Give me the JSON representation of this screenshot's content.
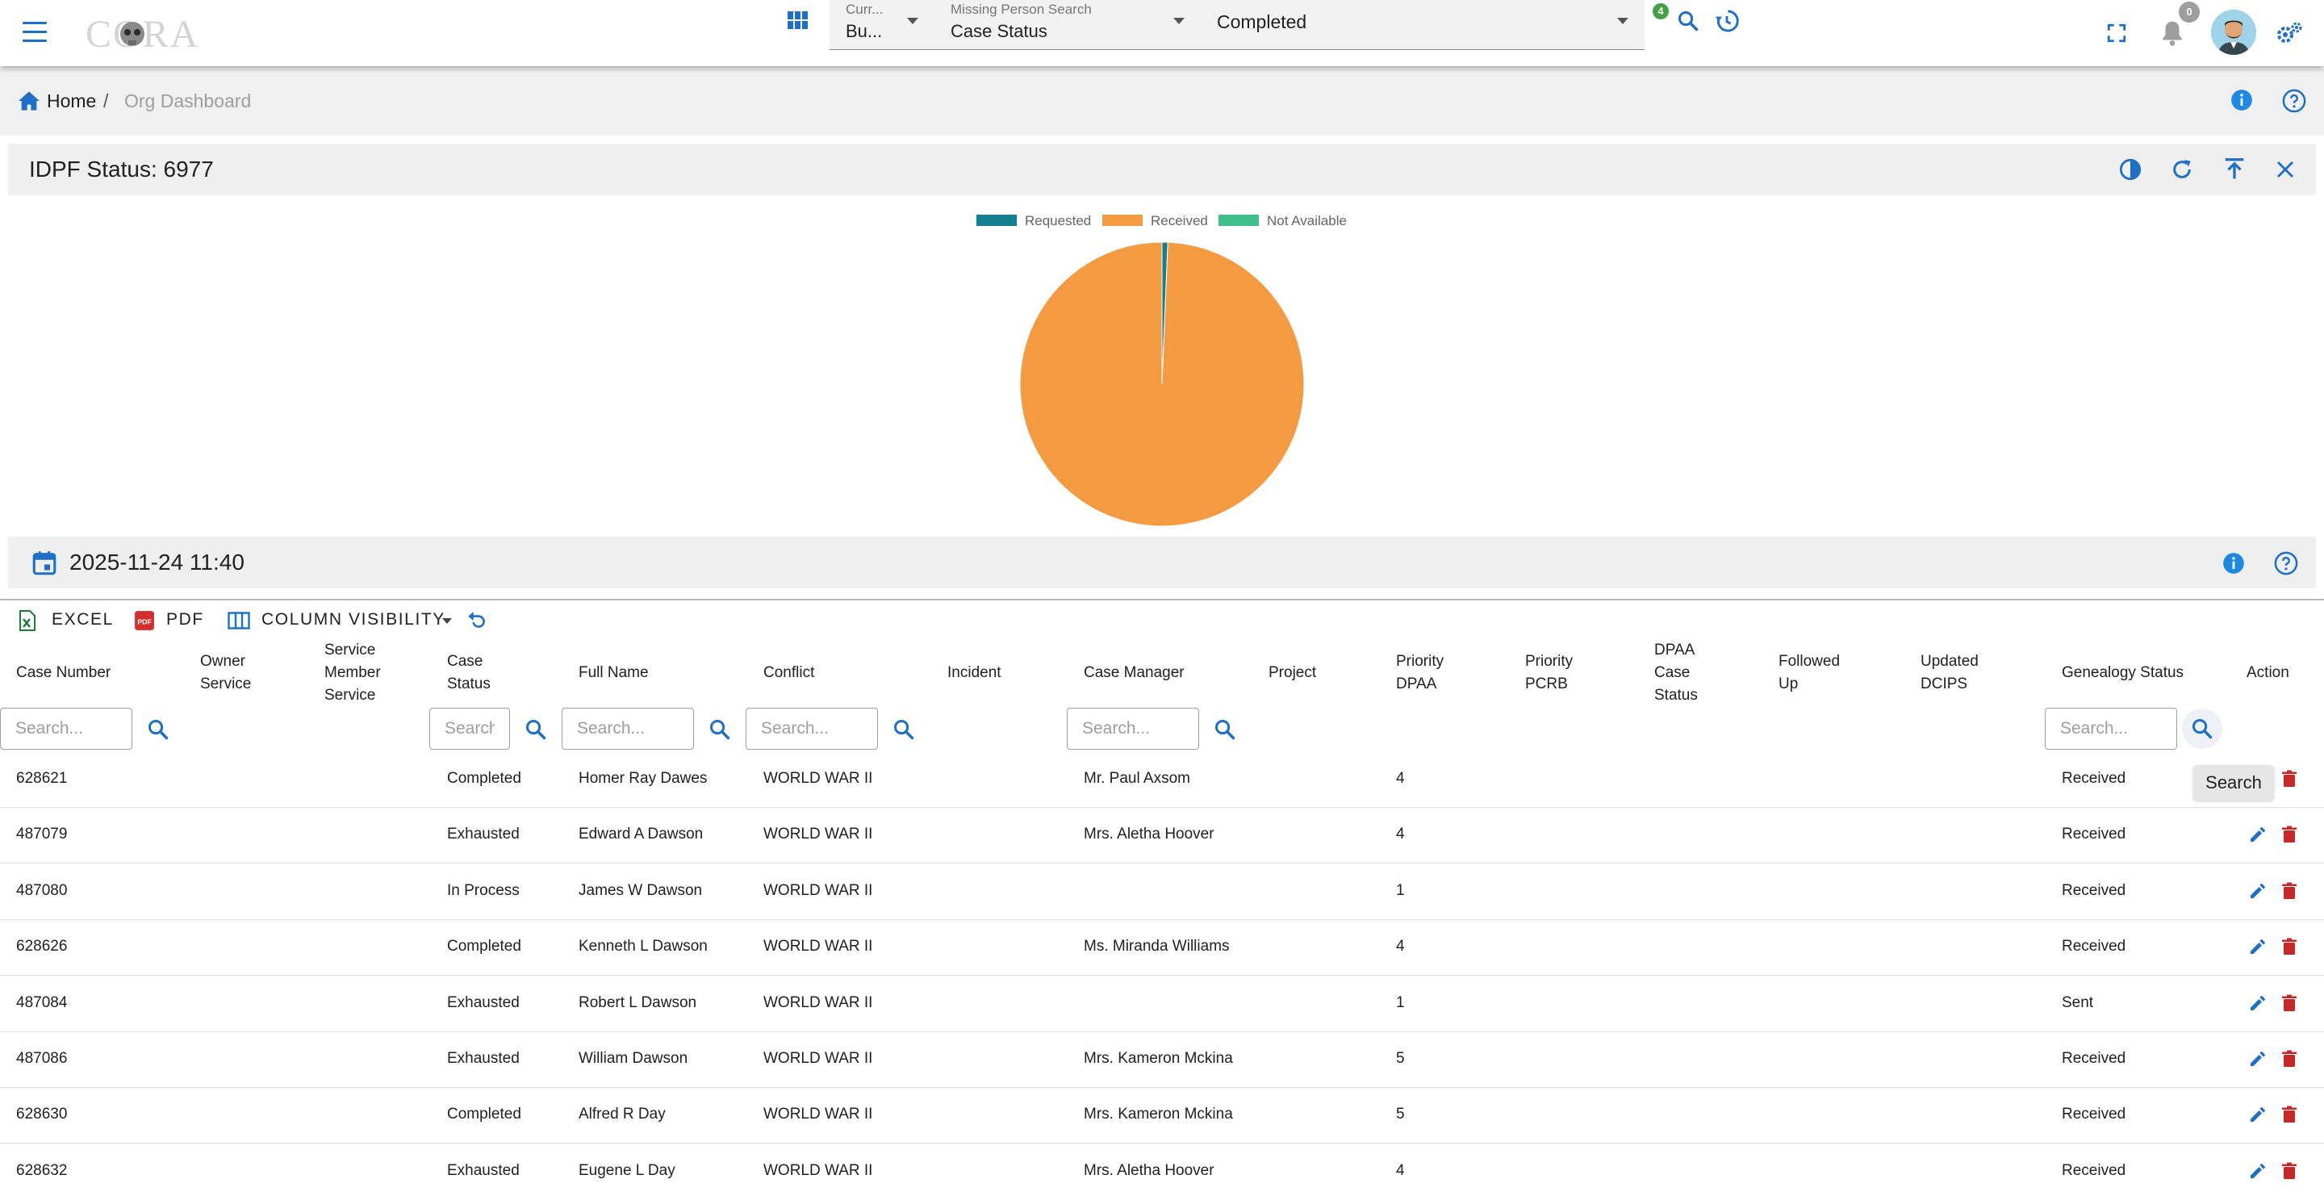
{
  "header": {
    "logo_text": "CORA",
    "current_label": "Curr...",
    "current_value": "Bu...",
    "search_type_label": "Missing Person Search",
    "search_type_value": "Case Status",
    "search_value": "Completed",
    "filter_badge": "4",
    "notification_count": "0"
  },
  "breadcrumb": {
    "home": "Home",
    "separator": "/",
    "current": "Org Dashboard"
  },
  "status_panel": {
    "title": "IDPF Status: 6977"
  },
  "chart_data": {
    "type": "pie",
    "categories": [
      "Requested",
      "Received",
      "Not Available"
    ],
    "values": [
      46,
      6931,
      0
    ],
    "colors": [
      "#12808f",
      "#f49b42",
      "#3fc08a"
    ],
    "legend": "top"
  },
  "date_panel": {
    "title": "2025-11-24 11:40"
  },
  "toolbar": {
    "excel": "EXCEL",
    "pdf": "PDF",
    "columns": "COLUMN VISIBILITY"
  },
  "table": {
    "headers": {
      "case_number": "Case Number",
      "owner_service": "Owner Service",
      "service_member_service": "Service Member Service",
      "case_status": "Case Status",
      "full_name": "Full Name",
      "conflict": "Conflict",
      "incident": "Incident",
      "case_manager": "Case Manager",
      "project": "Project",
      "priority_dpaa": "Priority DPAA",
      "priority_pcrb": "Priority PCRB",
      "dpaa_case_status": "DPAA Case Status",
      "followed_up": "Followed Up",
      "updated_dcips": "Updated DCIPS",
      "genealogy_status": "Genealogy Status",
      "action": "Action"
    },
    "search_placeholder": "Search...",
    "search_tooltip": "Search",
    "rows": [
      {
        "case_number": "628621",
        "case_status": "Completed",
        "full_name": "Homer Ray Dawes",
        "conflict": "WORLD WAR II",
        "case_manager": "Mr. Paul Axsom",
        "priority_dpaa": "4",
        "genealogy_status": "Received"
      },
      {
        "case_number": "487079",
        "case_status": "Exhausted",
        "full_name": "Edward A Dawson",
        "conflict": "WORLD WAR II",
        "case_manager": "Mrs. Aletha Hoover",
        "priority_dpaa": "4",
        "genealogy_status": "Received"
      },
      {
        "case_number": "487080",
        "case_status": "In Process",
        "full_name": "James W Dawson",
        "conflict": "WORLD WAR II",
        "case_manager": "",
        "priority_dpaa": "1",
        "genealogy_status": "Received"
      },
      {
        "case_number": "628626",
        "case_status": "Completed",
        "full_name": "Kenneth L Dawson",
        "conflict": "WORLD WAR II",
        "case_manager": "Ms. Miranda Williams",
        "priority_dpaa": "4",
        "genealogy_status": "Received"
      },
      {
        "case_number": "487084",
        "case_status": "Exhausted",
        "full_name": "Robert L Dawson",
        "conflict": "WORLD WAR II",
        "case_manager": "",
        "priority_dpaa": "1",
        "genealogy_status": "Sent"
      },
      {
        "case_number": "487086",
        "case_status": "Exhausted",
        "full_name": "William Dawson",
        "conflict": "WORLD WAR II",
        "case_manager": "Mrs. Kameron Mckina",
        "priority_dpaa": "5",
        "genealogy_status": "Received"
      },
      {
        "case_number": "628630",
        "case_status": "Completed",
        "full_name": "Alfred R Day",
        "conflict": "WORLD WAR II",
        "case_manager": "Mrs. Kameron Mckina",
        "priority_dpaa": "5",
        "genealogy_status": "Received"
      },
      {
        "case_number": "628632",
        "case_status": "Exhausted",
        "full_name": "Eugene L Day",
        "conflict": "WORLD WAR II",
        "case_manager": "Mrs. Aletha Hoover",
        "priority_dpaa": "4",
        "genealogy_status": "Received"
      }
    ]
  }
}
